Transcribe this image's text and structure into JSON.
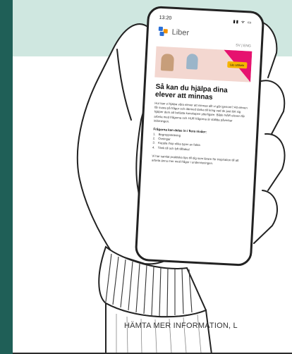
{
  "phone": {
    "time": "13:20",
    "status_icons": "▮▮ ᯤ ▭",
    "brand_name": "Liber",
    "lang_toggle": "SV | ENG",
    "banner_cta": "Läs artikeln",
    "headline": "Så kan du hjälpa dina elever att minnas",
    "intro": "Hur kan vi hjälpa våra elever att minnas allt vi går igenom? Att eleven får svara på frågor och därmed tänka till kring vad de just lärt sig hjälper dem att befästa kunskapen ytterligare. Både NÄR eleven får arbeta med frågorna och HUR frågorna är ställda påverkar inlärningen.",
    "list_title": "Frågorna kan delas in i flera nivåer:",
    "list_items": [
      "Begreppsträning",
      "Övningar",
      "Koppla ihop olika typer av fakta",
      "Tänk till och lyft tillbaka!"
    ],
    "note": "Vi har samlat praktiska tips till dig som lärare för inspiration till att arbeta ännu mer med frågor i undervisningen."
  },
  "caption": "HÄMTA MER INFORMATION, L",
  "colors": {
    "top_band": "#cfe7e0",
    "left_strip": "#1f5f57",
    "accent_magenta": "#e6126f",
    "accent_yellow": "#f6b400",
    "logo_blue": "#2b6fd6",
    "logo_orange": "#f39200"
  }
}
